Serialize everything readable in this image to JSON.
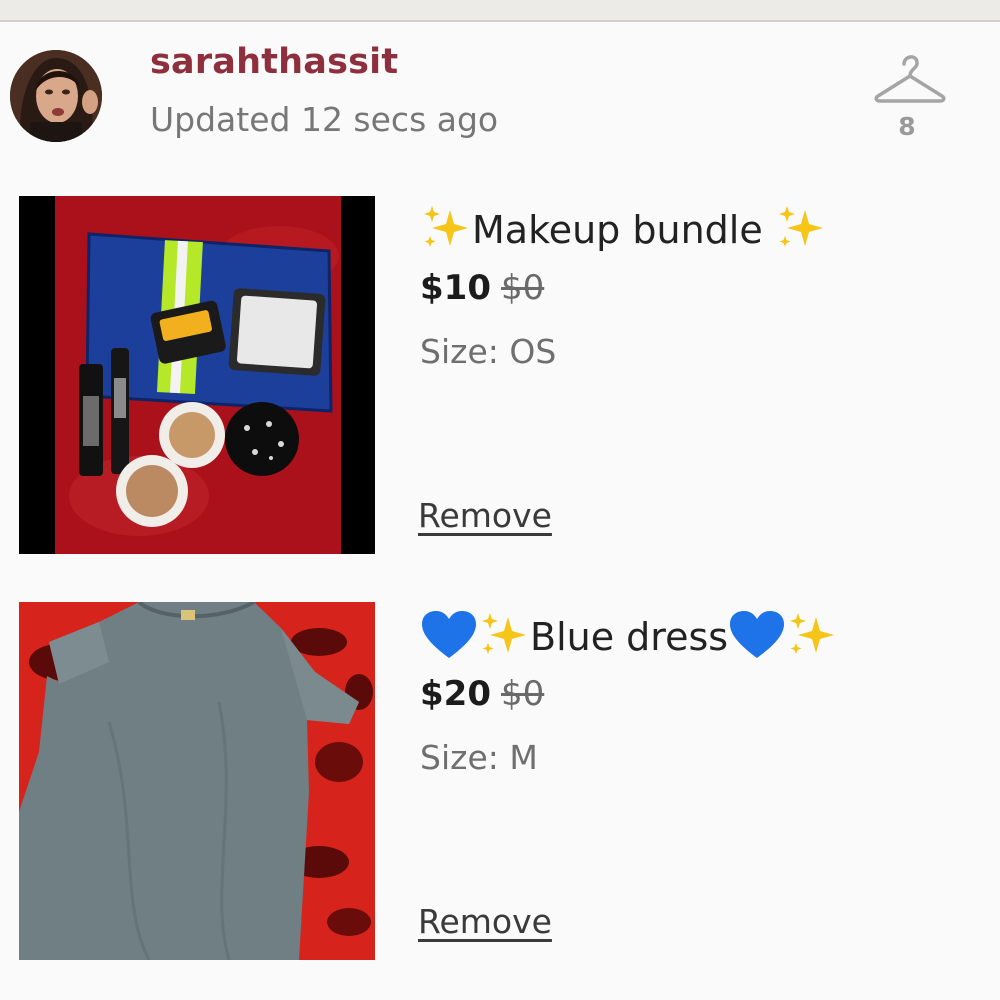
{
  "header": {
    "username": "sarahthassit",
    "updated": "Updated 12 secs ago",
    "hanger_count": "8"
  },
  "items": [
    {
      "title": "Makeup bundle",
      "price": "$10",
      "original_price": "$0",
      "size": "Size: OS",
      "remove_label": "Remove"
    },
    {
      "title": "Blue dress",
      "price": "$20",
      "original_price": "$0",
      "size": "Size: M",
      "remove_label": "Remove"
    }
  ],
  "colors": {
    "username": "#8e2f3e",
    "sparkle": "#f5c518",
    "heart": "#1f73e8"
  },
  "icons": [
    "hanger-icon",
    "sparkles-icon",
    "blue-heart-icon"
  ]
}
